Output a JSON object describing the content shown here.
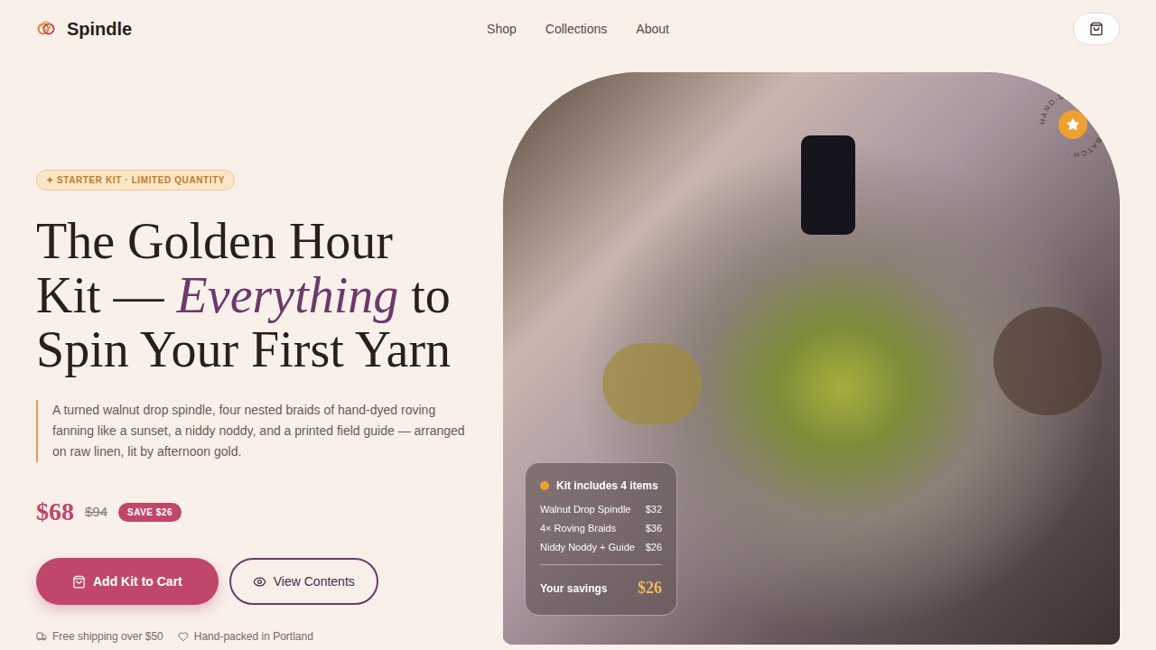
{
  "brand": {
    "name": "Spindle"
  },
  "nav": [
    {
      "label": "Shop"
    },
    {
      "label": "Collections"
    },
    {
      "label": "About"
    }
  ],
  "badge": "✦ STARTER KIT · LIMITED QUANTITY",
  "heading": {
    "lines": [
      [
        {
          "text": "The Golden Hour",
          "italic": false
        }
      ],
      [
        {
          "text": "Kit — ",
          "italic": false
        },
        {
          "text": "Everything",
          "italic": true
        },
        {
          "text": " to",
          "italic": false
        }
      ],
      [
        {
          "text": "Spin Your First Yarn",
          "italic": false
        }
      ]
    ]
  },
  "description": "A turned walnut drop spindle, four nested braids of hand-dyed roving fanning like a sunset, a niddy noddy, and a printed field guide — arranged on raw linen, lit by afternoon gold.",
  "price": {
    "current": "$68",
    "original": "$94",
    "save": "SAVE $26"
  },
  "buttons": [
    {
      "label": "Add Kit to Cart",
      "kind": "primary"
    },
    {
      "label": "View Contents",
      "kind": "secondary"
    }
  ],
  "perks": [
    {
      "label": "Free shipping over $50",
      "kind": "shipping"
    },
    {
      "label": "Hand-packed in Portland",
      "kind": "heart"
    }
  ],
  "stamp": "HAND-DYED · SMALL BATCH · ",
  "kit_card": {
    "title": "Kit includes 4 items",
    "items": [
      {
        "name": "Walnut Drop Spindle",
        "price": "$32"
      },
      {
        "name": "4× Roving Braids",
        "price": "$36"
      },
      {
        "name": "Niddy Noddy + Guide",
        "price": "$26"
      }
    ],
    "savings_label": "Your savings",
    "savings": "$26"
  }
}
